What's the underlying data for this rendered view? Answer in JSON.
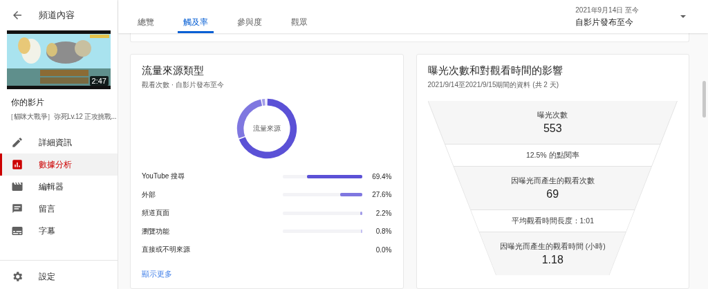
{
  "sidebar": {
    "back_title": "頻道內容",
    "video": {
      "duration": "2:47"
    },
    "video_label": "你的影片",
    "video_title": "［貓咪大戰爭］弥死Lv.12 正攻挑戰...",
    "items": [
      {
        "label": "詳細資訊",
        "selected": false
      },
      {
        "label": "數據分析",
        "selected": true
      },
      {
        "label": "編輯器",
        "selected": false
      },
      {
        "label": "留言",
        "selected": false
      },
      {
        "label": "字幕",
        "selected": false
      }
    ],
    "footer_items": [
      {
        "label": "設定",
        "selected": false
      }
    ]
  },
  "tabs": [
    {
      "label": "總覽",
      "selected": false
    },
    {
      "label": "觸及率",
      "selected": true
    },
    {
      "label": "參與度",
      "selected": false
    },
    {
      "label": "觀眾",
      "selected": false
    }
  ],
  "date_range": {
    "range": "2021年9月14日 至今",
    "label": "自影片發布至今"
  },
  "traffic_card": {
    "title": "流量來源類型",
    "subtitle": "觀看次數 · 自影片發布至今",
    "center_label": "流量來源",
    "rows": [
      {
        "label": "YouTube 搜尋",
        "level": 0.694,
        "value": "69.4%",
        "color": "#5b51d6"
      },
      {
        "label": "外部",
        "level": 0.276,
        "value": "27.6%",
        "color": "#7f77e0"
      },
      {
        "label": "頻道頁面",
        "level": 0.022,
        "value": "2.2%",
        "color": "#a29ce9"
      },
      {
        "label": "瀏覽功能",
        "level": 0.008,
        "value": "0.8%",
        "color": "#c3bff2"
      },
      {
        "label": "直接或不明來源",
        "value": "0.0%"
      }
    ],
    "more_link": "顯示更多"
  },
  "funnel_card": {
    "title": "曝光次數和對觀看時間的影響",
    "subtitle": "2021/9/14至2021/9/15期間的資料 (共 2 天)",
    "stages": [
      {
        "kind": "stage",
        "label": "曝光次數",
        "value": "553"
      },
      {
        "kind": "rate",
        "label": "12.5% 的點閱率"
      },
      {
        "kind": "stage",
        "label": "因曝光而產生的觀看次數",
        "value": "69"
      },
      {
        "kind": "rate",
        "label": "平均觀看時間長度：1:01"
      },
      {
        "kind": "stage",
        "label": "因曝光而產生的觀看時間 (小時)",
        "value": "1.18"
      }
    ]
  }
}
